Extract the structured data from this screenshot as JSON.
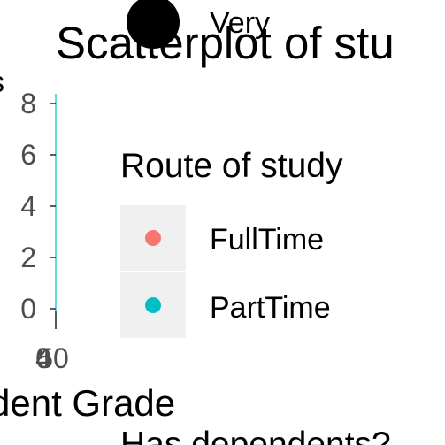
{
  "chart_data": {
    "type": "scatter",
    "title": "Scatterplot of stu",
    "xlabel": "dent Grade",
    "ylabel": "s",
    "x_ticks": [
      "0",
      "4",
      "50"
    ],
    "y_ticks": [
      "0",
      "2",
      "4",
      "6",
      "8"
    ],
    "ylim": [
      0,
      8
    ],
    "grid": false,
    "legend": {
      "size_item_label": "Very",
      "color_title": "Route of study",
      "color_items": [
        {
          "label": "FullTime",
          "color": "#F8766D"
        },
        {
          "label": "PartTime",
          "color": "#00BFC4"
        }
      ],
      "next_title": "Has dependents?"
    },
    "series": [
      {
        "name": "FullTime",
        "color": "#F8766D",
        "points": []
      },
      {
        "name": "PartTime",
        "color": "#00BFC4",
        "points": []
      }
    ]
  }
}
